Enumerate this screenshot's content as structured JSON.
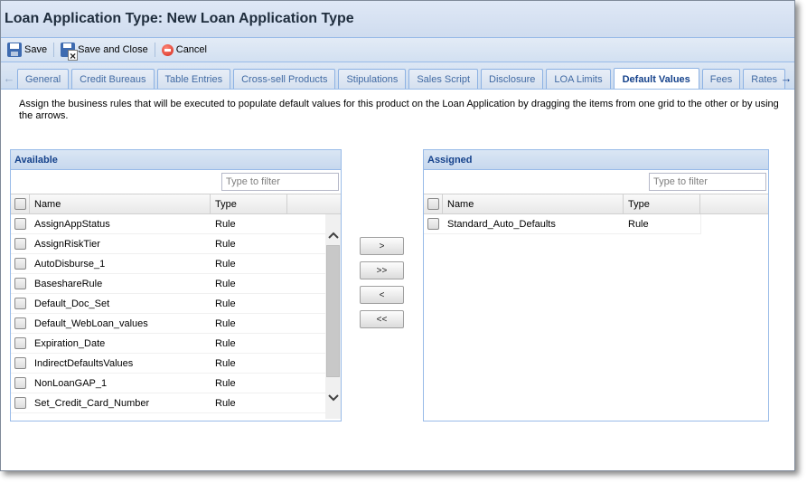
{
  "window": {
    "title": "Loan Application Type: New Loan Application Type"
  },
  "toolbar": {
    "save_label": "Save",
    "save_close_label": "Save and Close",
    "cancel_label": "Cancel"
  },
  "tabs": [
    {
      "label": "General"
    },
    {
      "label": "Credit Bureaus"
    },
    {
      "label": "Table Entries"
    },
    {
      "label": "Cross-sell Products"
    },
    {
      "label": "Stipulations"
    },
    {
      "label": "Sales Script"
    },
    {
      "label": "Disclosure"
    },
    {
      "label": "LOA Limits"
    },
    {
      "label": "Default Values",
      "active": true
    },
    {
      "label": "Fees"
    },
    {
      "label": "Rates"
    }
  ],
  "description": "Assign the business rules that will be executed to populate default values for this product on the Loan Application by dragging the items from one grid to the other or by using the arrows.",
  "available": {
    "title": "Available",
    "filter_placeholder": "Type to filter",
    "columns": {
      "name": "Name",
      "type": "Type"
    },
    "rows": [
      {
        "name": "AssignAppStatus",
        "type": "Rule"
      },
      {
        "name": "AssignRiskTier",
        "type": "Rule"
      },
      {
        "name": "AutoDisburse_1",
        "type": "Rule"
      },
      {
        "name": "BaseshareRule",
        "type": "Rule"
      },
      {
        "name": "Default_Doc_Set",
        "type": "Rule"
      },
      {
        "name": "Default_WebLoan_values",
        "type": "Rule"
      },
      {
        "name": "Expiration_Date",
        "type": "Rule"
      },
      {
        "name": "IndirectDefaultsValues",
        "type": "Rule"
      },
      {
        "name": "NonLoanGAP_1",
        "type": "Rule"
      },
      {
        "name": "Set_Credit_Card_Number",
        "type": "Rule"
      }
    ]
  },
  "assigned": {
    "title": "Assigned",
    "filter_placeholder": "Type to filter",
    "columns": {
      "name": "Name",
      "type": "Type"
    },
    "rows": [
      {
        "name": "Standard_Auto_Defaults",
        "type": "Rule"
      }
    ]
  },
  "move_buttons": {
    "move_right": ">",
    "move_all_right": ">>",
    "move_left": "<",
    "move_all_left": "<<"
  },
  "icons": {
    "save": "save-icon",
    "save_close": "save-close-icon",
    "cancel": "cancel-icon",
    "tab_scroll_left": "arrow-left-icon",
    "tab_scroll_right": "arrow-right-icon",
    "scroll_up": "chevron-up-icon",
    "scroll_down": "chevron-down-icon"
  }
}
